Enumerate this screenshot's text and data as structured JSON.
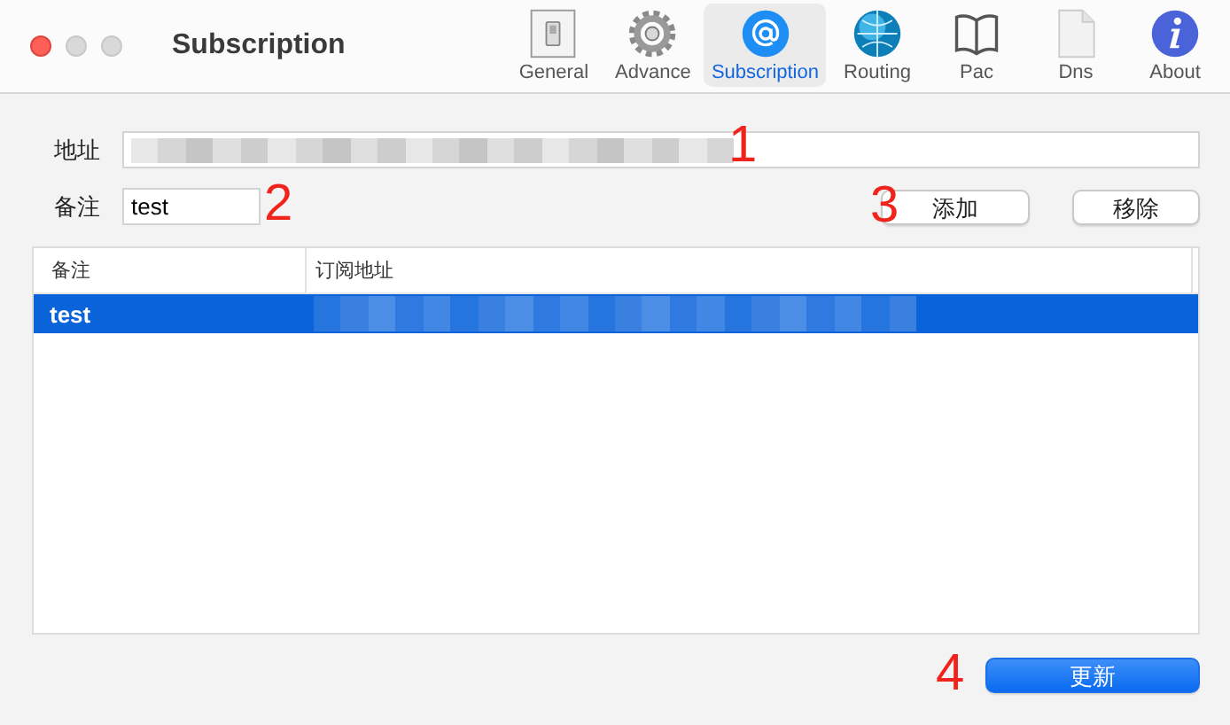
{
  "window": {
    "title": "Subscription"
  },
  "toolbar": [
    {
      "label": "General",
      "selected": false
    },
    {
      "label": "Advance",
      "selected": false
    },
    {
      "label": "Subscription",
      "selected": true
    },
    {
      "label": "Routing",
      "selected": false
    },
    {
      "label": "Pac",
      "selected": false
    },
    {
      "label": "Dns",
      "selected": false
    },
    {
      "label": "About",
      "selected": false
    }
  ],
  "address": {
    "label": "地址"
  },
  "remark": {
    "label": "备注",
    "value": "test"
  },
  "buttons": [
    {
      "label": "添加"
    },
    {
      "label": "移除"
    }
  ],
  "table": {
    "columns": [
      "备注",
      "订阅地址"
    ],
    "rows": [
      {
        "remark": "test",
        "selected": true
      }
    ]
  },
  "update_button": {
    "label": "更新"
  },
  "annotations": [
    "1",
    "2",
    "3",
    "4"
  ]
}
